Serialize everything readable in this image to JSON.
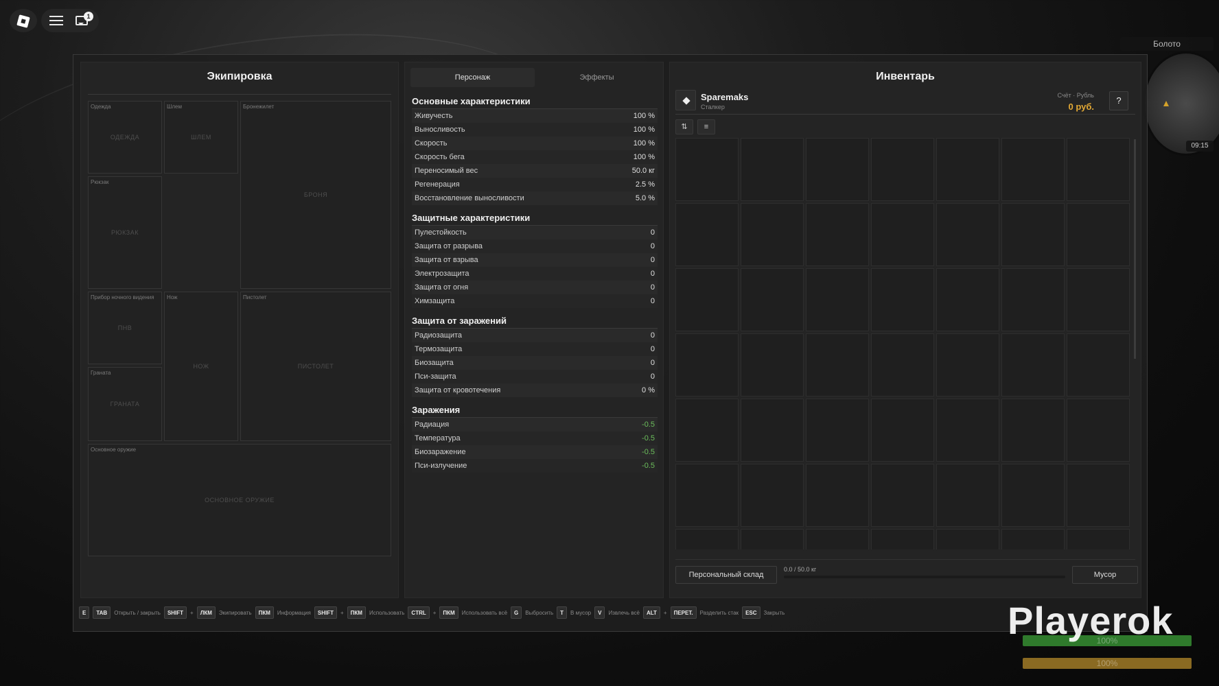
{
  "topbar": {
    "chat_badge": "1"
  },
  "minimap": {
    "location": "Болото",
    "time": "09:15"
  },
  "equipment": {
    "title": "Экипировка",
    "slots": {
      "clothes": {
        "label": "Одежда",
        "placeholder": "ОДЕЖДА"
      },
      "helmet": {
        "label": "Шлем",
        "placeholder": "ШЛЕМ"
      },
      "armor": {
        "label": "Бронежилет",
        "placeholder": "БРОНЯ"
      },
      "backpack": {
        "label": "Рюкзак",
        "placeholder": "РЮКЗАК"
      },
      "nvg": {
        "label": "Прибор ночного видения",
        "placeholder": "ПНВ"
      },
      "knife": {
        "label": "Нож",
        "placeholder": "НОЖ"
      },
      "pistol": {
        "label": "Пистолет",
        "placeholder": "ПИСТОЛЕТ"
      },
      "grenade": {
        "label": "Граната",
        "placeholder": "ГРАНАТА"
      },
      "primary": {
        "label": "Основное оружие",
        "placeholder": "ОСНОВНОЕ ОРУЖИЕ"
      }
    }
  },
  "stats": {
    "tabs": [
      "Персонаж",
      "Эффекты"
    ],
    "sections": [
      {
        "title": "Основные характеристики",
        "rows": [
          {
            "name": "Живучесть",
            "value": "100 %"
          },
          {
            "name": "Выносливость",
            "value": "100 %"
          },
          {
            "name": "Скорость",
            "value": "100 %"
          },
          {
            "name": "Скорость бега",
            "value": "100 %"
          },
          {
            "name": "Переносимый вес",
            "value": "50.0 кг"
          },
          {
            "name": "Регенерация",
            "value": "2.5 %"
          },
          {
            "name": "Восстановление выносливости",
            "value": "5.0 %"
          }
        ]
      },
      {
        "title": "Защитные характеристики",
        "rows": [
          {
            "name": "Пулестойкость",
            "value": "0"
          },
          {
            "name": "Защита от разрыва",
            "value": "0"
          },
          {
            "name": "Защита от взрыва",
            "value": "0"
          },
          {
            "name": "Электрозащита",
            "value": "0"
          },
          {
            "name": "Защита от огня",
            "value": "0"
          },
          {
            "name": "Химзащита",
            "value": "0"
          }
        ]
      },
      {
        "title": "Защита от заражений",
        "rows": [
          {
            "name": "Радиозащита",
            "value": "0"
          },
          {
            "name": "Термозащита",
            "value": "0"
          },
          {
            "name": "Биозащита",
            "value": "0"
          },
          {
            "name": "Пси-защита",
            "value": "0"
          },
          {
            "name": "Защита от кровотечения",
            "value": "0 %"
          }
        ]
      },
      {
        "title": "Заражения",
        "rows": [
          {
            "name": "Радиация",
            "value": "-0.5",
            "color": "#6cbf5c"
          },
          {
            "name": "Температура",
            "value": "-0.5",
            "color": "#6cbf5c"
          },
          {
            "name": "Биозаражение",
            "value": "-0.5",
            "color": "#6cbf5c"
          },
          {
            "name": "Пси-излучение",
            "value": "-0.5",
            "color": "#6cbf5c"
          }
        ]
      }
    ]
  },
  "inventory": {
    "title": "Инвентарь",
    "player_name": "Sparemaks",
    "player_rank": "Сталкер",
    "account_label": "Счёт · Рубль",
    "account_value": "0 руб.",
    "help_label": "?",
    "sort_icon": "sort-icon",
    "list_icon": "list-icon",
    "storage_button": "Персональный склад",
    "weight_text": "0.0 / 50.0 кг",
    "weight_fraction": 0.0,
    "trash_button": "Мусор",
    "grid_columns": 7,
    "grid_visible_rows": 7
  },
  "hotkeys": [
    {
      "keys": [
        "E",
        "TAB"
      ],
      "joiner": "",
      "label": "Открыть / закрыть"
    },
    {
      "keys": [
        "SHIFT",
        "ЛКМ"
      ],
      "joiner": "+",
      "label": "Экипировать"
    },
    {
      "keys": [
        "ПКМ"
      ],
      "joiner": "",
      "label": "Информация"
    },
    {
      "keys": [
        "SHIFT",
        "ПКМ"
      ],
      "joiner": "+",
      "label": "Использовать"
    },
    {
      "keys": [
        "CTRL",
        "ПКМ"
      ],
      "joiner": "+",
      "label": "Использовать всё"
    },
    {
      "keys": [
        "G"
      ],
      "joiner": "",
      "label": "Выбросить"
    },
    {
      "keys": [
        "T"
      ],
      "joiner": "",
      "label": "В мусор"
    },
    {
      "keys": [
        "V"
      ],
      "joiner": "",
      "label": "Извлечь всё"
    },
    {
      "keys": [
        "ALT",
        "ПЕРЕТ."
      ],
      "joiner": "+",
      "label": "Разделить стак"
    },
    {
      "keys": [
        "ESC"
      ],
      "joiner": "",
      "label": "Закрыть"
    }
  ],
  "hud": {
    "watermark": "Playerok",
    "health_text": "100%",
    "health_fraction": 1.0,
    "stamina_text": "100%",
    "stamina_fraction": 1.0
  }
}
